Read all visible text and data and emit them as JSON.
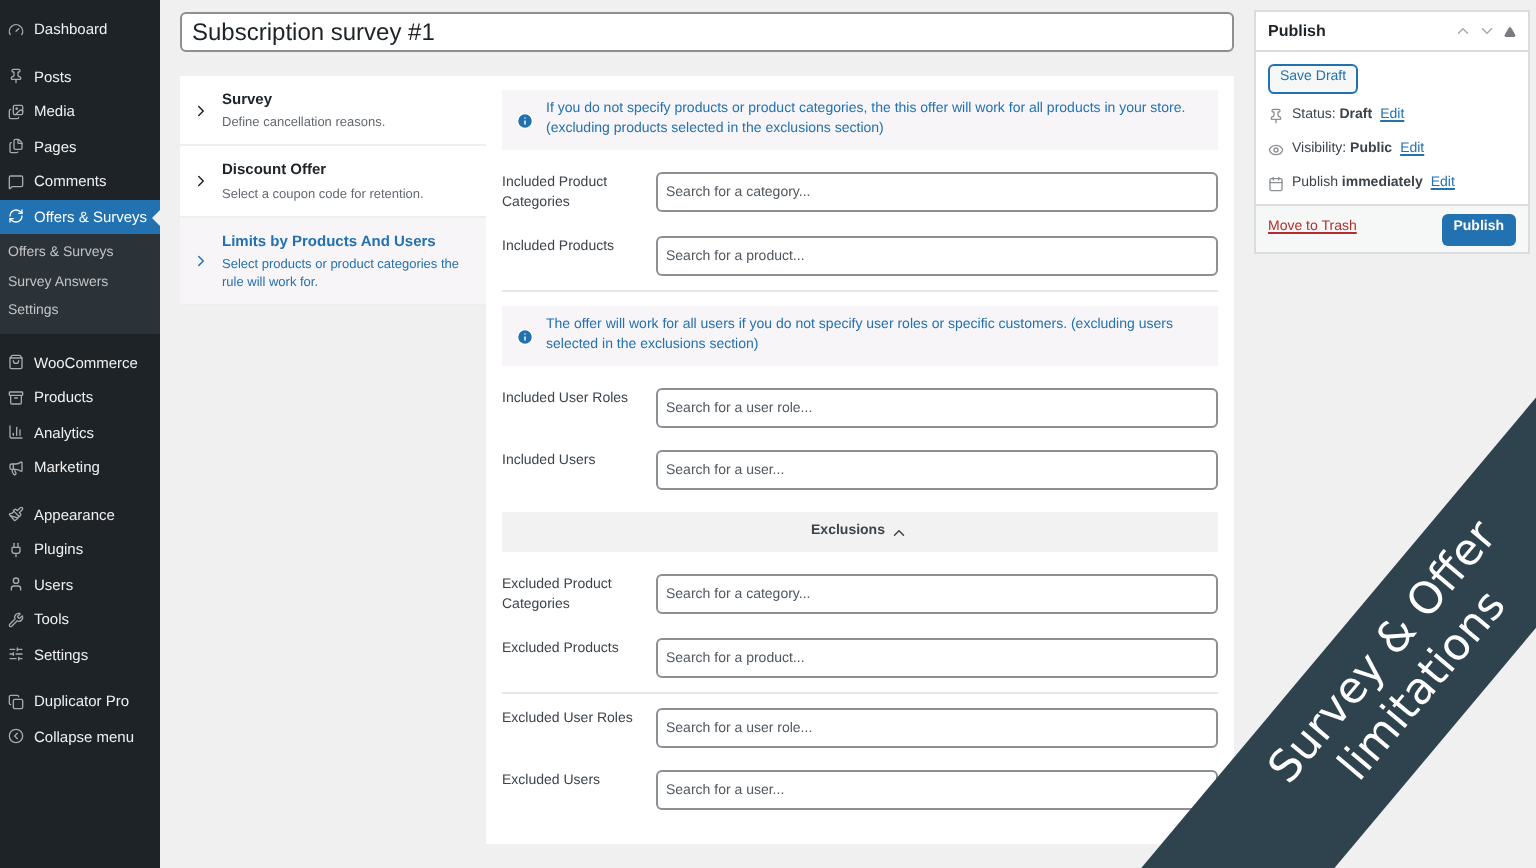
{
  "sidebar": {
    "groups": [
      [
        {
          "label": "Dashboard",
          "selected": false
        }
      ],
      [
        {
          "label": "Posts",
          "selected": false
        },
        {
          "label": "Media",
          "selected": false
        },
        {
          "label": "Pages",
          "selected": false
        },
        {
          "label": "Comments",
          "selected": false
        },
        {
          "label": "Offers & Surveys",
          "selected": true,
          "children": [
            {
              "label": "Offers & Surveys",
              "selected": false
            },
            {
              "label": "Survey Answers",
              "selected": false
            },
            {
              "label": "Settings",
              "selected": false
            }
          ]
        }
      ],
      [
        {
          "label": "WooCommerce",
          "selected": false
        },
        {
          "label": "Products",
          "selected": false
        },
        {
          "label": "Analytics",
          "selected": false
        },
        {
          "label": "Marketing",
          "selected": false
        }
      ],
      [
        {
          "label": "Appearance",
          "selected": false
        },
        {
          "label": "Plugins",
          "selected": false
        },
        {
          "label": "Users",
          "selected": false
        },
        {
          "label": "Tools",
          "selected": false
        },
        {
          "label": "Settings",
          "selected": false
        }
      ],
      [
        {
          "label": "Duplicator Pro",
          "selected": false
        },
        {
          "label": "Collapse menu",
          "selected": false
        }
      ]
    ]
  },
  "title_field": {
    "value": "Subscription survey #1"
  },
  "steps": [
    {
      "title": "Survey",
      "description": "Define cancellation reasons.",
      "selected": false
    },
    {
      "title": "Discount Offer",
      "description": "Select a coupon code for retention.",
      "selected": false
    },
    {
      "title": "Limits by Products And Users",
      "description": "Select products or product categories the rule will work for.",
      "selected": true
    }
  ],
  "sections": [
    {
      "kind": "notice",
      "text": "If you do not specify products or product categories, the this offer will work for all products in your store. (excluding products selected in the exclusions section)"
    },
    {
      "kind": "field",
      "label": "Included Product Categories",
      "placeholder": "Search for a category..."
    },
    {
      "kind": "field",
      "label": "Included Products",
      "placeholder": "Search for a product..."
    },
    {
      "kind": "divider"
    },
    {
      "kind": "notice",
      "text": "The offer will work for all users if you do not specify user roles or specific customers. (excluding users selected in the exclusions section)"
    },
    {
      "kind": "field",
      "label": "Included User Roles",
      "placeholder": "Search for a user role..."
    },
    {
      "kind": "field",
      "label": "Included Users",
      "placeholder": "Search for a user..."
    },
    {
      "kind": "toggle",
      "label": "Exclusions",
      "expanded": true
    },
    {
      "kind": "field",
      "label": "Excluded Product Categories",
      "placeholder": "Search for a category..."
    },
    {
      "kind": "field",
      "label": "Excluded Products",
      "placeholder": "Search for a product..."
    },
    {
      "kind": "divider"
    },
    {
      "kind": "field",
      "label": "Excluded User Roles",
      "placeholder": "Search for a user role..."
    },
    {
      "kind": "field",
      "label": "Excluded Users",
      "placeholder": "Search for a user..."
    }
  ],
  "publish": {
    "title": "Publish",
    "save_button": "Save Draft",
    "rows": [
      {
        "text": "Status: **Draft**",
        "link": "Edit"
      },
      {
        "text": "Visibility: **Public**",
        "link": "Edit"
      },
      {
        "text": "Publish **immediately**",
        "link": "Edit"
      }
    ],
    "trash_link": "Move to Trash",
    "publish_button": "Publish"
  },
  "ribbon": {
    "lines": [
      "Survey & Offer",
      "limitations"
    ]
  }
}
